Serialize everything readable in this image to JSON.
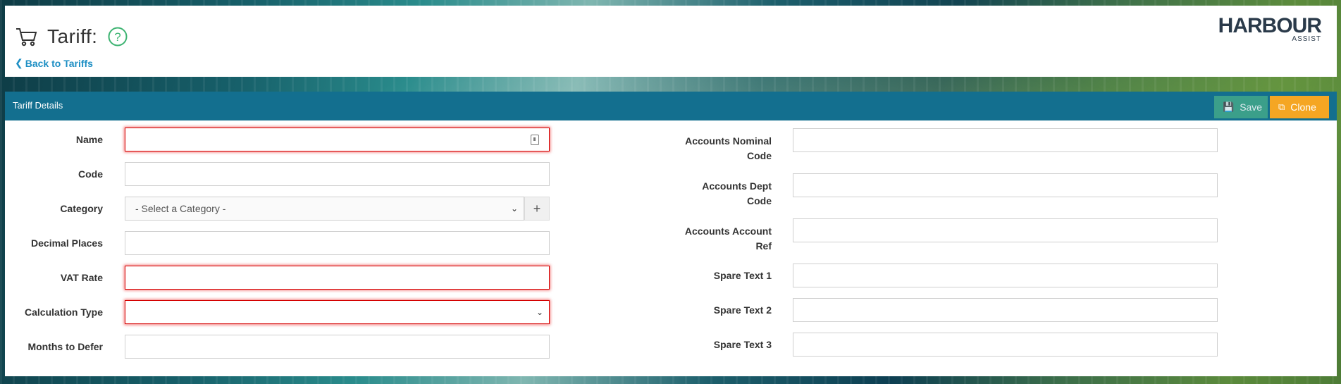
{
  "header": {
    "title": "Tariff:",
    "back_link": "Back to Tariffs",
    "logo_main": "HARBOUR",
    "logo_sub": "ASSIST"
  },
  "panel": {
    "title": "Tariff Details",
    "save_label": "Save",
    "clone_label": "Clone"
  },
  "left_fields": {
    "name": {
      "label": "Name",
      "value": ""
    },
    "code": {
      "label": "Code",
      "value": ""
    },
    "category": {
      "label": "Category",
      "value": "- Select a Category -"
    },
    "decimal_places": {
      "label": "Decimal Places",
      "value": ""
    },
    "vat_rate": {
      "label": "VAT Rate",
      "value": ""
    },
    "calculation_type": {
      "label": "Calculation Type",
      "value": ""
    },
    "months_to_defer": {
      "label": "Months to Defer",
      "value": ""
    }
  },
  "right_fields": {
    "accounts_nominal_code": {
      "label_line1": "Accounts Nominal",
      "label_line2": "Code",
      "value": ""
    },
    "accounts_dept_code": {
      "label_line1": "Accounts Dept",
      "label_line2": "Code",
      "value": ""
    },
    "accounts_account_ref": {
      "label_line1": "Accounts Account",
      "label_line2": "Ref",
      "value": ""
    },
    "spare_text_1": {
      "label": "Spare Text 1",
      "value": ""
    },
    "spare_text_2": {
      "label": "Spare Text 2",
      "value": ""
    },
    "spare_text_3": {
      "label": "Spare Text 3",
      "value": ""
    }
  },
  "colors": {
    "panel_header": "#136f8f",
    "save_button": "#43a88a",
    "clone_button": "#f5a623",
    "link": "#1e8fc4",
    "error_border": "#d40000"
  }
}
